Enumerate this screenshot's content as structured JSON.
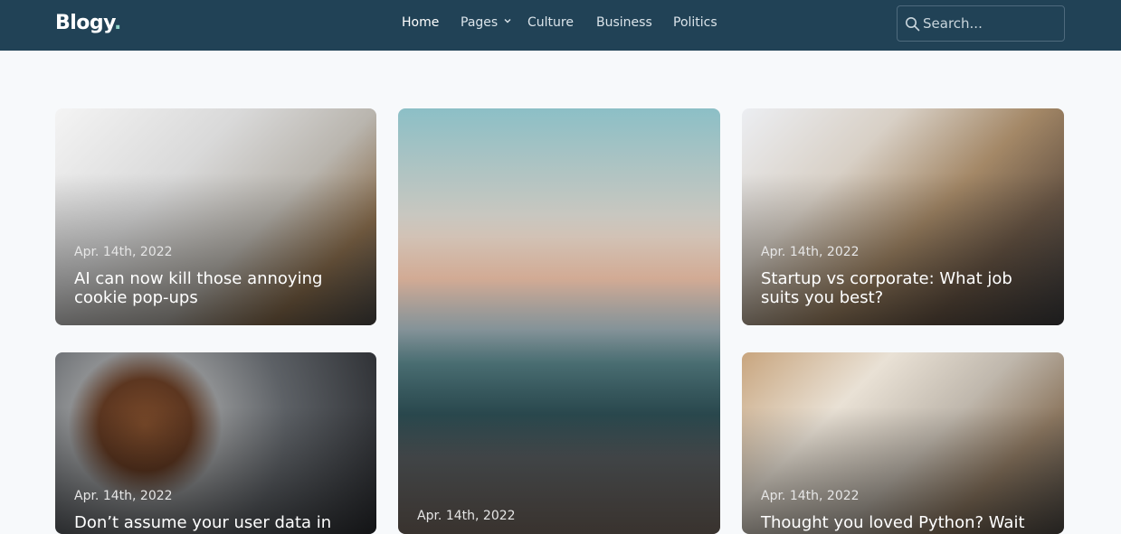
{
  "header": {
    "logo": "Blogy",
    "logo_dot": ".",
    "nav": [
      {
        "label": "Home",
        "active": true
      },
      {
        "label": "Pages",
        "has_dropdown": true
      },
      {
        "label": "Culture"
      },
      {
        "label": "Business"
      },
      {
        "label": "Politics"
      }
    ],
    "search": {
      "placeholder": "Search..."
    }
  },
  "posts": [
    {
      "date": "Apr. 14th, 2022",
      "title": "AI can now kill those annoying cookie pop-ups"
    },
    {
      "date": "Apr. 14th, 2022",
      "title": ""
    },
    {
      "date": "Apr. 14th, 2022",
      "title": "Startup vs corporate: What job suits you best?"
    },
    {
      "date": "Apr. 14th, 2022",
      "title": "Don’t assume your user data in the"
    },
    {
      "date": "Apr. 14th, 2022",
      "title": "Thought you loved Python? Wait"
    }
  ],
  "colors": {
    "header_bg": "#214256",
    "page_bg": "#f7f9fb",
    "logo_dot": "#8fd3c8"
  }
}
